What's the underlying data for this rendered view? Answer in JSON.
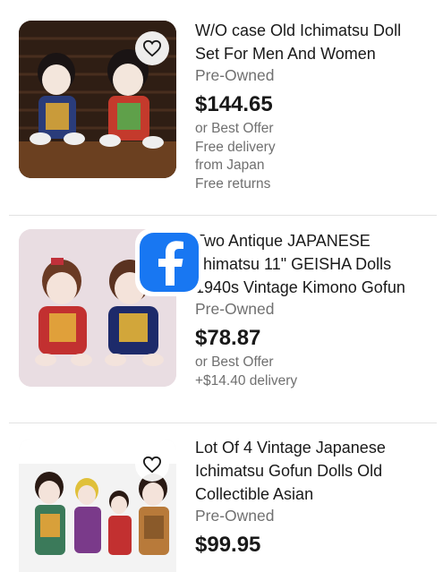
{
  "listings": [
    {
      "title_lines": [
        "W/O case Old Ichimatsu Doll",
        "Set For Men And Women"
      ],
      "condition": "Pre-Owned",
      "price": "$144.65",
      "details": [
        "or Best Offer",
        "Free delivery",
        "from Japan",
        "Free returns"
      ],
      "image": "two-ichimatsu-dolls-photo"
    },
    {
      "title_lines": [
        "Two Antique JAPANESE",
        "chimatsu 11\" GEISHA Dolls",
        "1940s Vintage Kimono Gofun"
      ],
      "condition": "Pre-Owned",
      "price": "$78.87",
      "details": [
        "or Best Offer",
        "+$14.40 delivery"
      ],
      "image": "two-geisha-dolls-photo"
    },
    {
      "title_lines": [
        "Lot Of 4 Vintage Japanese",
        "Ichimatsu Gofun Dolls Old",
        "Collectible Asian"
      ],
      "condition": "Pre-Owned",
      "price": "$99.95",
      "details": [],
      "image": "four-dolls-photo"
    }
  ],
  "overlay": {
    "icon": "facebook-icon",
    "color": "#1877f2"
  },
  "icons": {
    "favorite": "heart-icon"
  }
}
